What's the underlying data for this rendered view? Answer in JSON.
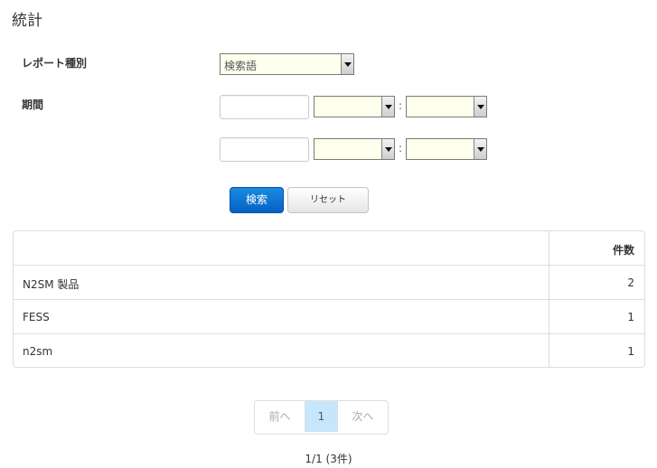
{
  "page": {
    "title": "統計"
  },
  "form": {
    "report_type_label": "レポート種別",
    "report_type_value": "検索語",
    "period_label": "期間",
    "from": {
      "date": "",
      "hour": "",
      "minute": ""
    },
    "to": {
      "date": "",
      "hour": "",
      "minute": ""
    },
    "separator": ":",
    "search_button": "検索",
    "reset_button": "リセット"
  },
  "table": {
    "headers": [
      "",
      "件数"
    ],
    "rows": [
      {
        "name": "N2SM 製品",
        "count": "2"
      },
      {
        "name": "FESS",
        "count": "1"
      },
      {
        "name": "n2sm",
        "count": "1"
      }
    ]
  },
  "pagination": {
    "prev": "前へ",
    "current": "1",
    "next": "次へ",
    "info": "1/1 (3件)"
  },
  "colors": {
    "primary": "#0a72d6",
    "select_bg": "#ffffee",
    "active_page": "#c6e6fb"
  }
}
